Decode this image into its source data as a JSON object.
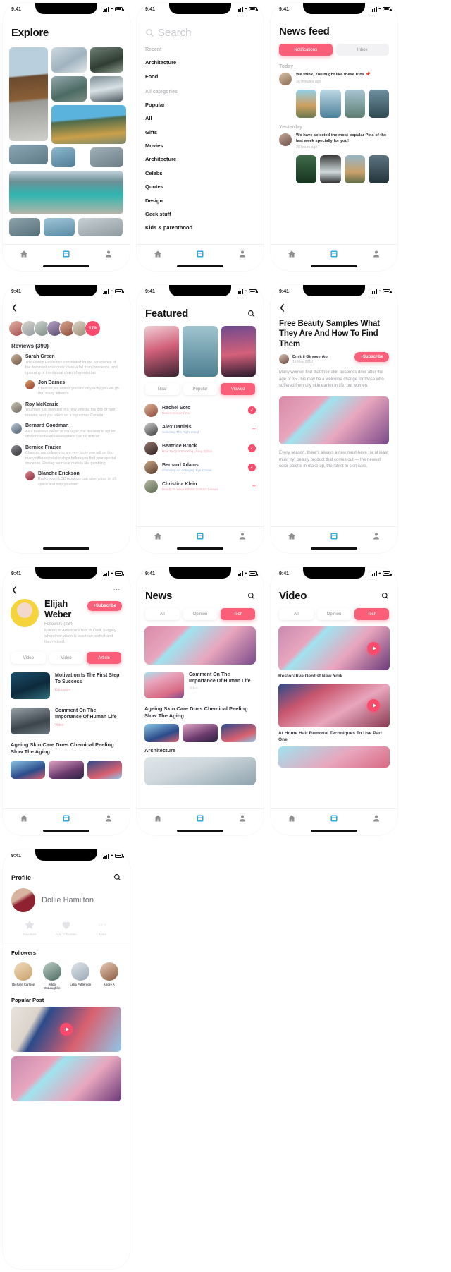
{
  "status_bar": {
    "time": "9:41"
  },
  "screens": {
    "explore": {
      "title": "Explore",
      "nav": [
        "home-icon",
        "feed-icon",
        "person-icon"
      ]
    },
    "search": {
      "placeholder": "Search",
      "search_icon": "search-icon",
      "recent_label": "Recent",
      "recent": [
        "Architecture",
        "Food"
      ],
      "all_label": "All categories",
      "categories": [
        "Popular",
        "All",
        "Gifts",
        "Movies",
        "Architecture",
        "Celebs",
        "Quotes",
        "Design",
        "Geek stuff",
        "Kids & parenthood"
      ]
    },
    "news_feed": {
      "title": "News feed",
      "tabs": [
        {
          "label": "Notifications",
          "active": true
        },
        {
          "label": "Inbox",
          "active": false
        }
      ],
      "groups": [
        {
          "label": "Today",
          "text": "We think, You might like these Pins 📌",
          "time": "30 minutes ago"
        },
        {
          "label": "Yesterday",
          "text": "We have selected the most popular Pins of the last week specially for you!",
          "time": "20 hours ago"
        }
      ]
    },
    "reviews": {
      "back_icon": "chevron-left-icon",
      "story_count": "179",
      "heading": "Reviews (390)",
      "items": [
        {
          "name": "Sarah Green",
          "text": "The French Revolution constituted for the conscience of the dominant aristocratic class a fall from innocence, and upturning of the natural chain of events that",
          "reply": {
            "name": "Jon Barnes",
            "text": "Chances are unless you are very lucky you will go thru many different"
          }
        },
        {
          "name": "Roy McKenzie",
          "text": "You have just invested in a new vehicle, the one of your dreams, and you take it on a trip across Canada."
        },
        {
          "name": "Bernard Goodman",
          "text": "As a business owner or manager, the decision to opt for offshore software development can be difficult."
        },
        {
          "name": "Bernice Frazier",
          "text": "Chances are unless you are very lucky you will go thru many different relationships before you find your special someone. Finding your sole mate is like gambling.",
          "reply": {
            "name": "Blanche Erickson",
            "text": "Rack mount LCD monitors can save you a lot of space and help you form"
          }
        }
      ]
    },
    "featured": {
      "title": "Featured",
      "search_icon": "search-icon",
      "chips": [
        {
          "label": "Near",
          "active": false
        },
        {
          "label": "Popular",
          "active": false
        },
        {
          "label": "Viewed",
          "active": true
        }
      ],
      "people": [
        {
          "name": "Rachel Soto",
          "sub": "Recommended You",
          "state": "check"
        },
        {
          "name": "Alex Daniels",
          "sub": "Selecting The Right Hood",
          "state": "plus"
        },
        {
          "name": "Beatrice Brock",
          "sub": "How To Quit Smoking Using Zyban",
          "state": "check"
        },
        {
          "name": "Bernard Adams",
          "sub": "Choosing An Antiaging Eye Cream",
          "state": "check"
        },
        {
          "name": "Christina Klein",
          "sub": "Ready To Wear Bifocal Contact Lenses",
          "state": "plus"
        }
      ]
    },
    "article": {
      "back_icon": "chevron-left-icon",
      "heading": "Free Beauty Samples What They Are And How To Find Them",
      "author": "Dmitrii Giryavenko",
      "date": "19 May 2018",
      "subscribe_label": "+Subscribe",
      "paragraph1": "Many women find that their skin becomes drier after the age of 35.This may be a welcome change for those who suffered from oily skin earlier in life, but women.",
      "paragraph2": "Every season, there's always a new must-have (or at least must try) beauty product that comes out — the newest color palette in make-up, the latest in skin care."
    },
    "user_profile": {
      "back_icon": "chevron-left-icon",
      "more_icon": "ellipsis-icon",
      "name": "Elijah Weber",
      "followers": "Followers (234)",
      "bio": "Millions of Americans turn to Lasik Surgery when their vision is less than perfect and they're tired.",
      "subscribe_label": "+Subscribe",
      "chips": [
        {
          "label": "Video",
          "active": false
        },
        {
          "label": "Video",
          "active": false
        },
        {
          "label": "Article",
          "active": true
        }
      ],
      "posts": [
        {
          "title": "Motivation Is The First Step To Success",
          "cat": "Education"
        },
        {
          "title": "Comment On The Importance Of Human Life",
          "cat": "Video"
        }
      ],
      "section_title": "Ageing Skin Care Does Chemical Peeling Slow The Aging"
    },
    "news": {
      "title": "News",
      "search_icon": "search-icon",
      "chips": [
        {
          "label": "All",
          "active": false
        },
        {
          "label": "Opinion",
          "active": false
        },
        {
          "label": "Tech",
          "active": true
        }
      ],
      "post": {
        "title": "Comment On The Importance Of Human Life",
        "cat": "Video"
      },
      "section_title": "Ageing Skin Care Does Chemical Peeling Slow The Aging",
      "section_title2": "Architecture"
    },
    "video": {
      "title": "Video",
      "search_icon": "search-icon",
      "chips": [
        {
          "label": "All",
          "active": false
        },
        {
          "label": "Opinion",
          "active": false
        },
        {
          "label": "Tech",
          "active": true
        }
      ],
      "videos": [
        {
          "caption": "Restorative Dentist New York"
        },
        {
          "caption": "At Home Hair Removal Techniques To Use Part One"
        }
      ]
    },
    "profile": {
      "title": "Profile",
      "search_icon": "search-icon",
      "name": "Dollie Hamilton",
      "actions": [
        {
          "icon": "star-icon",
          "label": "Favorites"
        },
        {
          "icon": "heart-icon",
          "label": "Add to favorite"
        },
        {
          "icon": "ellipsis-icon",
          "label": "More"
        }
      ],
      "followers_label": "Followers",
      "followers": [
        "Richard Carlson",
        "Hilda McLaughlin",
        "Lelia Patterson",
        "Andre A"
      ],
      "popular_label": "Popular Post"
    }
  },
  "colors": {
    "accent": "#FB5E78",
    "accent_dark": "#FB4A6B",
    "tab_active": "#29ABE2",
    "text": "#111111",
    "muted": "#b8b8bd"
  }
}
